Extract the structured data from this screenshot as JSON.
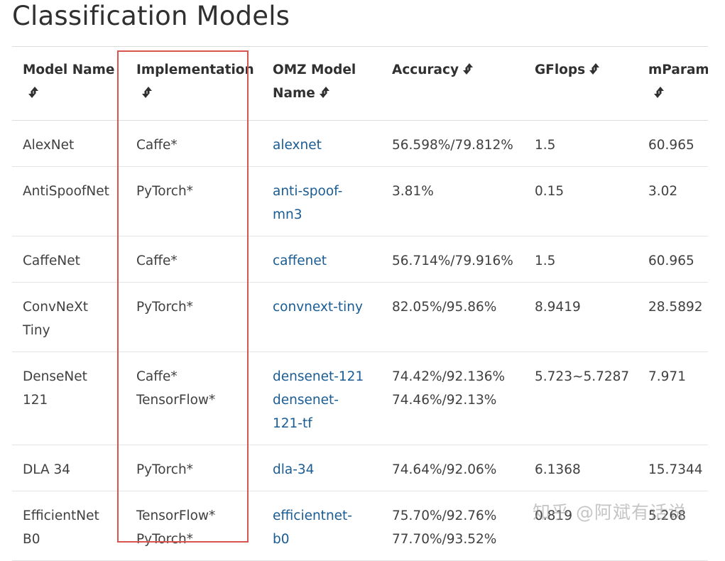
{
  "page": {
    "title": "Classification Models"
  },
  "table": {
    "headers": [
      {
        "key": "model_name",
        "lines": [
          "Model Name"
        ]
      },
      {
        "key": "implementation",
        "lines": [
          "Implementation"
        ]
      },
      {
        "key": "omz_model_name",
        "lines": [
          "OMZ Model",
          "Name"
        ]
      },
      {
        "key": "accuracy",
        "lines": [
          "",
          "Accuracy"
        ]
      },
      {
        "key": "gflops",
        "lines": [
          "",
          "GFlops"
        ]
      },
      {
        "key": "mparams",
        "lines": [
          "mParam"
        ]
      }
    ],
    "rows": [
      {
        "model_name": [
          "AlexNet"
        ],
        "implementation": [
          "Caffe*"
        ],
        "omz_model_name": [
          "alexnet"
        ],
        "accuracy": [
          "56.598%/79.812%"
        ],
        "gflops": [
          "1.5"
        ],
        "mparams": [
          "60.965"
        ]
      },
      {
        "model_name": [
          "AntiSpoofNet"
        ],
        "implementation": [
          "PyTorch*"
        ],
        "omz_model_name": [
          "anti-spoof-",
          "mn3"
        ],
        "accuracy": [
          "3.81%"
        ],
        "gflops": [
          "0.15"
        ],
        "mparams": [
          "3.02"
        ]
      },
      {
        "model_name": [
          "CaffeNet"
        ],
        "implementation": [
          "Caffe*"
        ],
        "omz_model_name": [
          "caffenet"
        ],
        "accuracy": [
          "56.714%/79.916%"
        ],
        "gflops": [
          "1.5"
        ],
        "mparams": [
          "60.965"
        ]
      },
      {
        "model_name": [
          "ConvNeXt",
          "Tiny"
        ],
        "implementation": [
          "PyTorch*"
        ],
        "omz_model_name": [
          "convnext-tiny"
        ],
        "accuracy": [
          "82.05%/95.86%"
        ],
        "gflops": [
          "8.9419"
        ],
        "mparams": [
          "28.5892"
        ]
      },
      {
        "model_name": [
          "DenseNet",
          "121"
        ],
        "implementation": [
          "Caffe*",
          "TensorFlow*"
        ],
        "omz_model_name": [
          "densenet-121",
          "densenet-",
          "121-tf"
        ],
        "accuracy": [
          "74.42%/92.136%",
          "74.46%/92.13%"
        ],
        "gflops": [
          "5.723~5.7287"
        ],
        "mparams": [
          "7.971"
        ]
      },
      {
        "model_name": [
          "DLA 34"
        ],
        "implementation": [
          "PyTorch*"
        ],
        "omz_model_name": [
          "dla-34"
        ],
        "accuracy": [
          "74.64%/92.06%"
        ],
        "gflops": [
          "6.1368"
        ],
        "mparams": [
          "15.7344"
        ]
      },
      {
        "model_name": [
          "EfficientNet",
          "B0"
        ],
        "implementation": [
          "TensorFlow*",
          "PyTorch*"
        ],
        "omz_model_name": [
          "efficientnet-",
          "b0"
        ],
        "accuracy": [
          "75.70%/92.76%",
          "77.70%/93.52%"
        ],
        "gflops": [
          "0.819"
        ],
        "mparams": [
          "5.268"
        ]
      }
    ]
  },
  "watermark": "知乎 @阿斌有话说",
  "colors": {
    "link": "#1a5c93",
    "highlight": "#d9534f",
    "text": "#404040"
  },
  "icons": {
    "sort": "sort-arrows-icon"
  }
}
